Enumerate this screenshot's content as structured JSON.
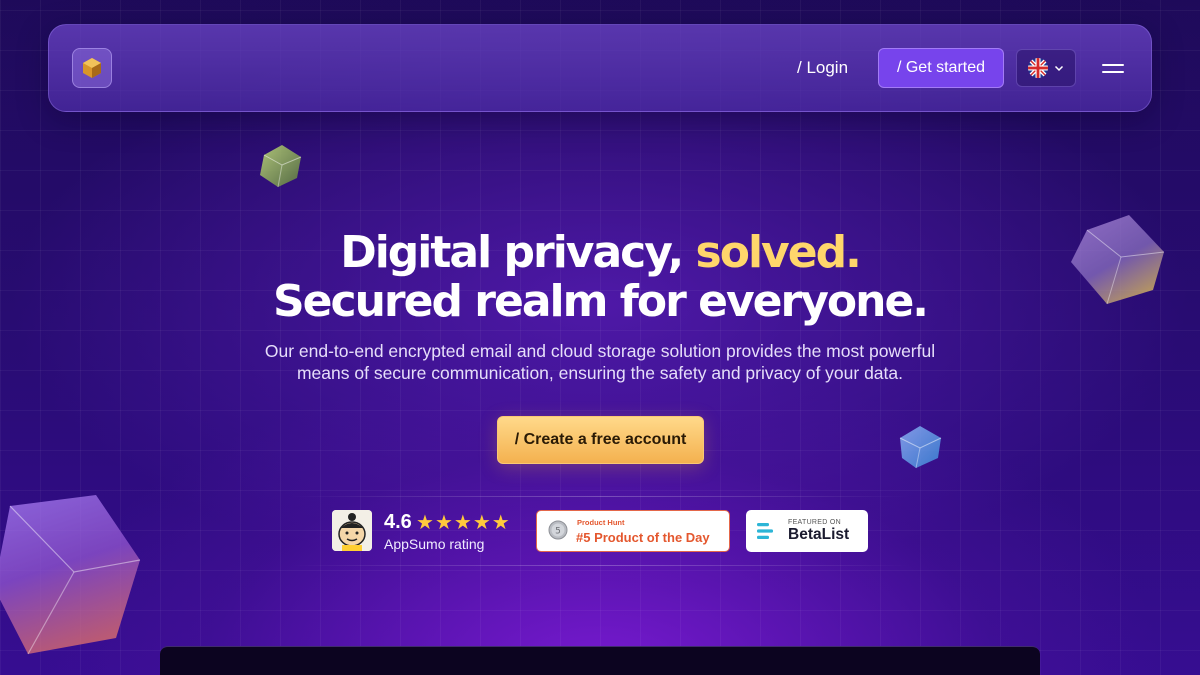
{
  "header": {
    "logo_icon": "cube-logo-icon",
    "login_label": "/ Login",
    "get_started_label": "/ Get started",
    "language": {
      "flag_icon": "uk-flag-icon",
      "dropdown_icon": "chevron-down-icon"
    },
    "menu_icon": "hamburger-menu-icon"
  },
  "hero": {
    "headline_part1": "Digital privacy, ",
    "headline_highlight": "solved.",
    "headline_line2": "Secured realm for everyone.",
    "subtext_line1": "Our end-to-end encrypted email and cloud storage solution provides the most powerful",
    "subtext_line2": "means of secure communication, ensuring the safety and privacy of your data.",
    "cta_label": "/ Create a free account"
  },
  "badges": {
    "appsumo": {
      "rating": "4.6",
      "stars": 5,
      "label": "AppSumo rating"
    },
    "producthunt": {
      "small": "Product Hunt",
      "main": "#5 Product of the Day",
      "medal": "5"
    },
    "betalist": {
      "small": "FEATURED ON",
      "main": "BetaList"
    }
  },
  "colors": {
    "accent_yellow": "#ffd66b",
    "button_purple": "#7744ec",
    "cta_gold": "#f4b14f",
    "producthunt_red": "#e4572e"
  }
}
